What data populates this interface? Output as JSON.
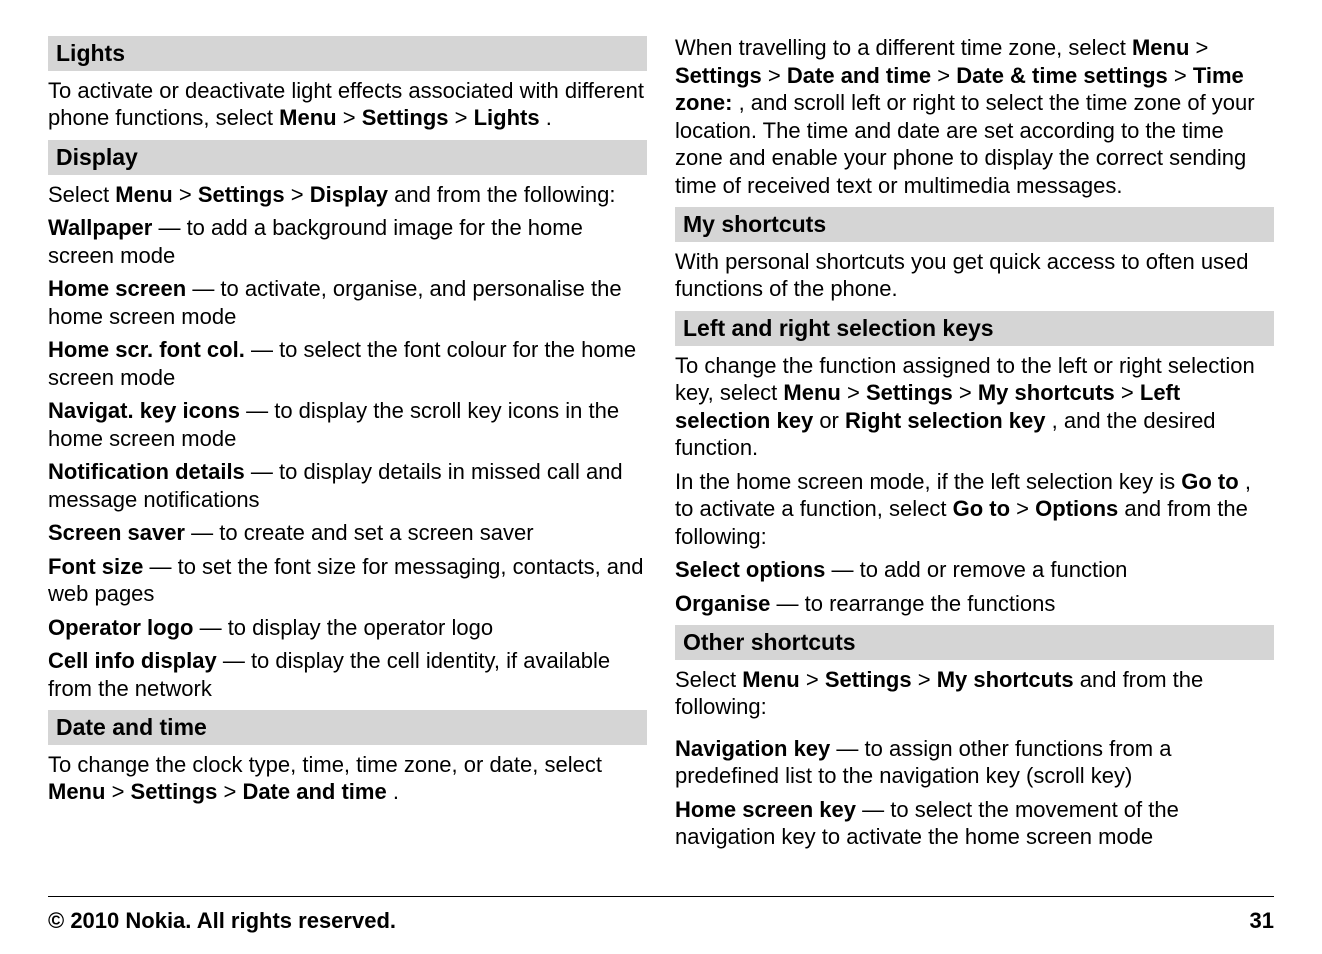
{
  "left": {
    "lights": {
      "heading": "Lights",
      "p1a": "To activate or deactivate light effects associated with different phone functions, select ",
      "menu": "Menu",
      "gt1": " > ",
      "settings": "Settings",
      "gt2": " > ",
      "lightsb": "Lights",
      "dot": "."
    },
    "display": {
      "heading": "Display",
      "intro_a": "Select ",
      "menu": "Menu",
      "gt1": " > ",
      "settings": "Settings",
      "gt2": " > ",
      "displayb": "Display",
      "intro_b": " and from the following:",
      "items": [
        {
          "label": "Wallpaper",
          "desc": "  — to add a background image for the home screen mode"
        },
        {
          "label": "Home screen",
          "desc": "  — to activate, organise, and personalise the home screen mode"
        },
        {
          "label": "Home scr. font col.",
          "desc": "  — to select the font colour for the home screen mode"
        },
        {
          "label": "Navigat. key icons",
          "desc": "  — to display the scroll key icons in the home screen mode"
        },
        {
          "label": "Notification details",
          "desc": "  — to display details in missed call and message notifications"
        },
        {
          "label": "Screen saver",
          "desc": "  — to create and set a screen saver"
        },
        {
          "label": "Font size",
          "desc": "  — to set the font size for messaging, contacts, and web pages"
        },
        {
          "label": "Operator logo",
          "desc": "  — to display the operator logo"
        },
        {
          "label": "Cell info display",
          "desc": "  — to display the cell identity, if available from the network"
        }
      ]
    },
    "date": {
      "heading": "Date and time",
      "p1a": "To change the clock type, time, time zone, or date, select ",
      "menu": "Menu",
      "gt1": " > ",
      "settings": "Settings",
      "gt2": " > ",
      "dtb": "Date and time",
      "dot": "."
    }
  },
  "right": {
    "tz": {
      "p1a": "When travelling to a different time zone, select ",
      "menu": "Menu",
      "gt1": " > ",
      "settings": "Settings",
      "gt2": " > ",
      "dt": "Date and time",
      "gt3": " > ",
      "dts": "Date & time settings",
      "gt4": " > ",
      "tzone": "Time zone:",
      "p1b": ", and scroll left or right to select the time zone of your location. The time and date are set according to the time zone and enable your phone to display the correct sending time of received text or multimedia messages."
    },
    "ms": {
      "heading": "My shortcuts",
      "p1": "With personal shortcuts you get quick access to often used functions of the phone."
    },
    "lr": {
      "heading": "Left and right selection keys",
      "p1a": "To change the function assigned to the left or right selection key, select ",
      "menu": "Menu",
      "gt1": " > ",
      "settings": "Settings",
      "gt2": " > ",
      "mysh": "My shortcuts",
      "gt3": " > ",
      "lsk": "Left selection key",
      "or": " or ",
      "rsk": "Right selection key",
      "p1b": ", and the desired function.",
      "p2a": "In the home screen mode, if the left selection key is ",
      "goto1": "Go to",
      "p2b": ", to activate a function, select ",
      "goto2": "Go to",
      "gt4": " > ",
      "options": "Options",
      "p2c": " and from the following:",
      "items": [
        {
          "label": "Select options",
          "desc": "  — to add or remove a function"
        },
        {
          "label": "Organise",
          "desc": "  — to rearrange the functions"
        }
      ]
    },
    "other": {
      "heading": "Other shortcuts",
      "p1a": "Select ",
      "menu": "Menu",
      "gt1": " > ",
      "settings": "Settings",
      "gt2": " > ",
      "mysh": "My shortcuts",
      "p1b": " and from the following:",
      "items": [
        {
          "label": "Navigation key",
          "desc": "  — to assign other functions from a predefined list to the navigation key (scroll key)"
        },
        {
          "label": "Home screen key",
          "desc": "  — to select the movement of the navigation key to activate the home screen mode"
        }
      ]
    }
  },
  "footer": {
    "copyright": "© 2010 Nokia. All rights reserved.",
    "page": "31"
  }
}
